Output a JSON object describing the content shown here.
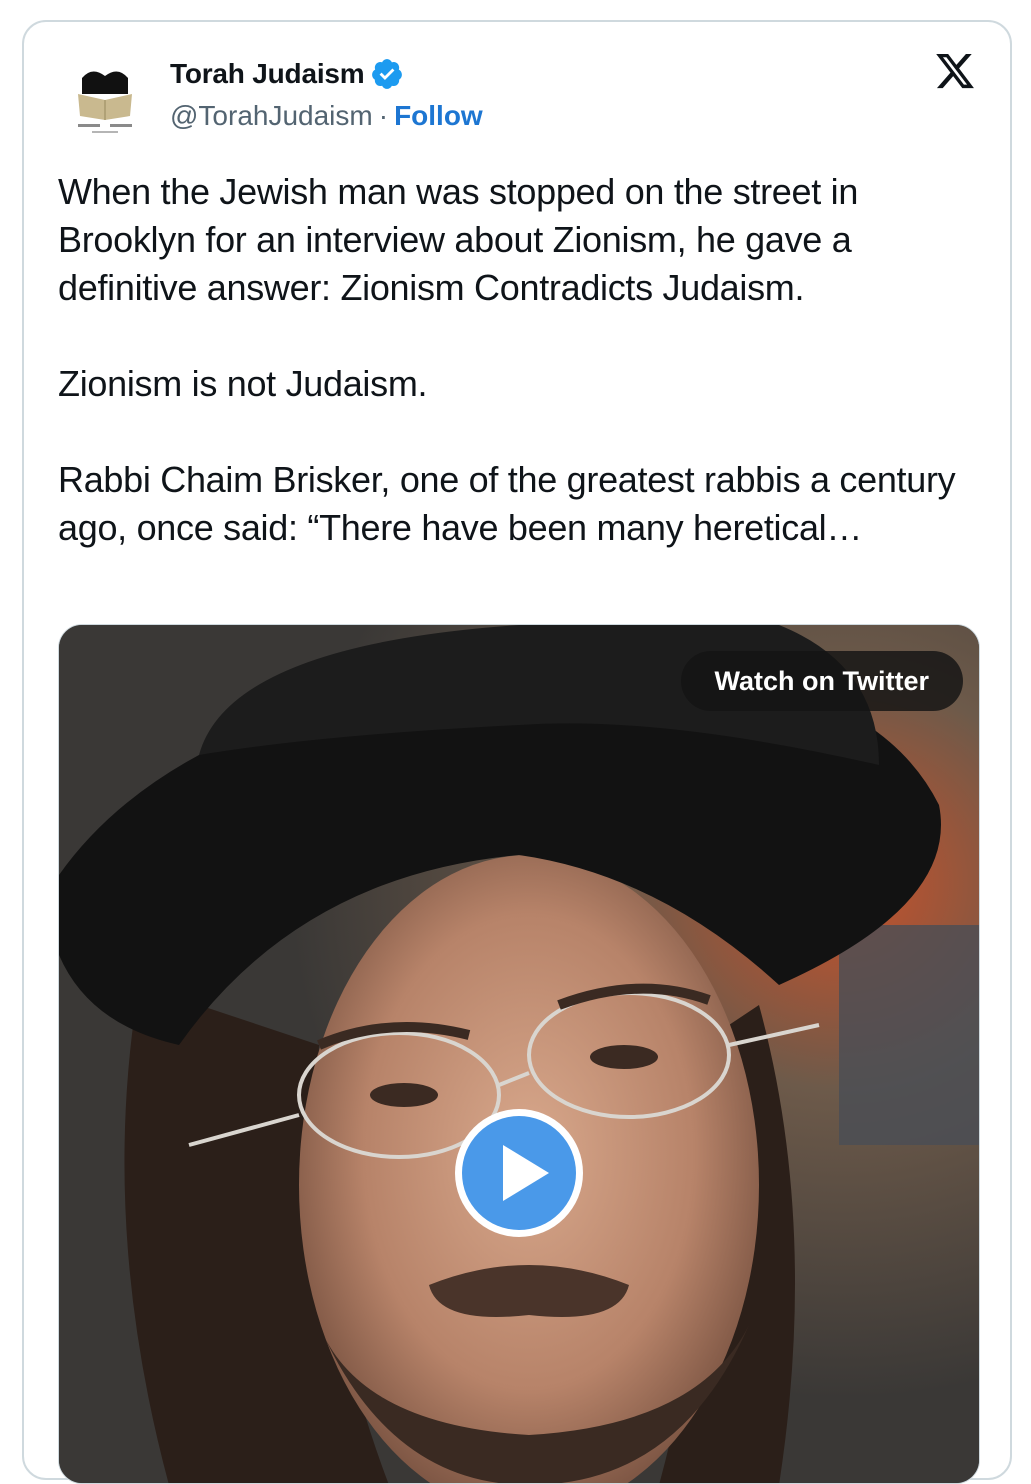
{
  "tweet": {
    "author": {
      "display_name": "Torah Judaism",
      "handle": "@TorahJudaism",
      "separator": "·",
      "follow_label": "Follow",
      "verified_icon": "verified-badge-icon",
      "avatar_icon": "torah-book-logo"
    },
    "brand_icon": "x-logo-icon",
    "text_paragraphs": [
      "When the Jewish man was stopped on the street in Brooklyn for an interview about Zionism, he gave a definitive answer: Zionism Contradicts Judaism.",
      "Zionism is not Judaism.",
      "Rabbi Chaim Brisker, one of the greatest rabbis a century ago, once said: “There have been many heretical…"
    ],
    "media": {
      "type": "video",
      "watch_label": "Watch on Twitter",
      "play_icon": "play-icon"
    }
  },
  "colors": {
    "verified_blue": "#1d9bf0",
    "follow_blue": "#1d76d2",
    "text": "#0f1419",
    "secondary_text": "#536471",
    "play_blue": "#4a99e9"
  }
}
